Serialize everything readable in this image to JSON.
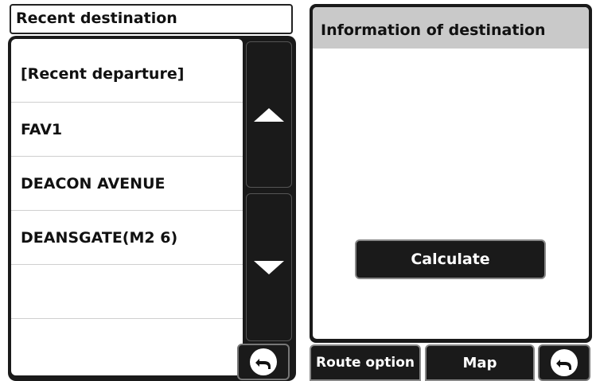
{
  "left_panel": {
    "title": "Recent destination",
    "items": [
      {
        "label": "[Recent departure]"
      },
      {
        "label": "FAV1"
      },
      {
        "label": "DEACON AVENUE"
      },
      {
        "label": "DEANSGATE(M2 6)"
      },
      {
        "label": ""
      },
      {
        "label": ""
      }
    ]
  },
  "right_panel": {
    "header": "Information of destination",
    "calculate_label": "Calculate",
    "tabs": {
      "route_option": "Route option",
      "map": "Map"
    }
  },
  "icons": {
    "scroll_up": "triangle-up-icon",
    "scroll_down": "triangle-down-icon",
    "back": "u-turn-back-arrow-icon"
  },
  "colors": {
    "button_bg": "#1a1a1a",
    "header_bg": "#c9c9c9",
    "text": "#111111"
  }
}
